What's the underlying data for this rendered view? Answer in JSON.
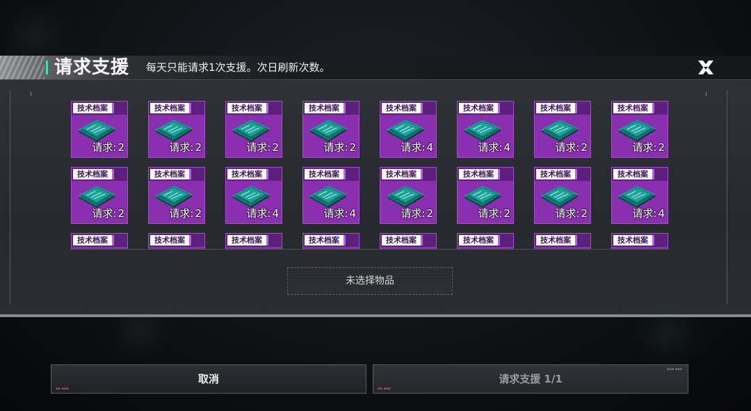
{
  "header": {
    "title": "请求支援",
    "subtitle": "每天只能请求1次支援。次日刷新次数。"
  },
  "items": [
    {
      "tag": "技术档案",
      "label": "请求:",
      "count": "2"
    },
    {
      "tag": "技术档案",
      "label": "请求:",
      "count": "2"
    },
    {
      "tag": "技术档案",
      "label": "请求:",
      "count": "2"
    },
    {
      "tag": "技术档案",
      "label": "请求:",
      "count": "2"
    },
    {
      "tag": "技术档案",
      "label": "请求:",
      "count": "4"
    },
    {
      "tag": "技术档案",
      "label": "请求:",
      "count": "4"
    },
    {
      "tag": "技术档案",
      "label": "请求:",
      "count": "2"
    },
    {
      "tag": "技术档案",
      "label": "请求:",
      "count": "2"
    },
    {
      "tag": "技术档案",
      "label": "请求:",
      "count": "2"
    },
    {
      "tag": "技术档案",
      "label": "请求:",
      "count": "2"
    },
    {
      "tag": "技术档案",
      "label": "请求:",
      "count": "4"
    },
    {
      "tag": "技术档案",
      "label": "请求:",
      "count": "4"
    },
    {
      "tag": "技术档案",
      "label": "请求:",
      "count": "2"
    },
    {
      "tag": "技术档案",
      "label": "请求:",
      "count": "2"
    },
    {
      "tag": "技术档案",
      "label": "请求:",
      "count": "2"
    },
    {
      "tag": "技术档案",
      "label": "请求:",
      "count": "4"
    },
    {
      "tag": "技术档案",
      "label": "",
      "count": ""
    },
    {
      "tag": "技术档案",
      "label": "",
      "count": ""
    },
    {
      "tag": "技术档案",
      "label": "",
      "count": ""
    },
    {
      "tag": "技术档案",
      "label": "",
      "count": ""
    },
    {
      "tag": "技术档案",
      "label": "",
      "count": ""
    },
    {
      "tag": "技术档案",
      "label": "",
      "count": ""
    },
    {
      "tag": "技术档案",
      "label": "",
      "count": ""
    },
    {
      "tag": "技术档案",
      "label": "",
      "count": ""
    }
  ],
  "selection": {
    "empty_text": "未选择物品"
  },
  "buttons": {
    "cancel": "取消",
    "request": "请求支援 1/1"
  },
  "icons": {
    "close": "close-x-icon",
    "item": "blueprint-document-icon"
  },
  "colors": {
    "item_bg": "#8a2fb0",
    "accent": "#3ee0b0"
  }
}
